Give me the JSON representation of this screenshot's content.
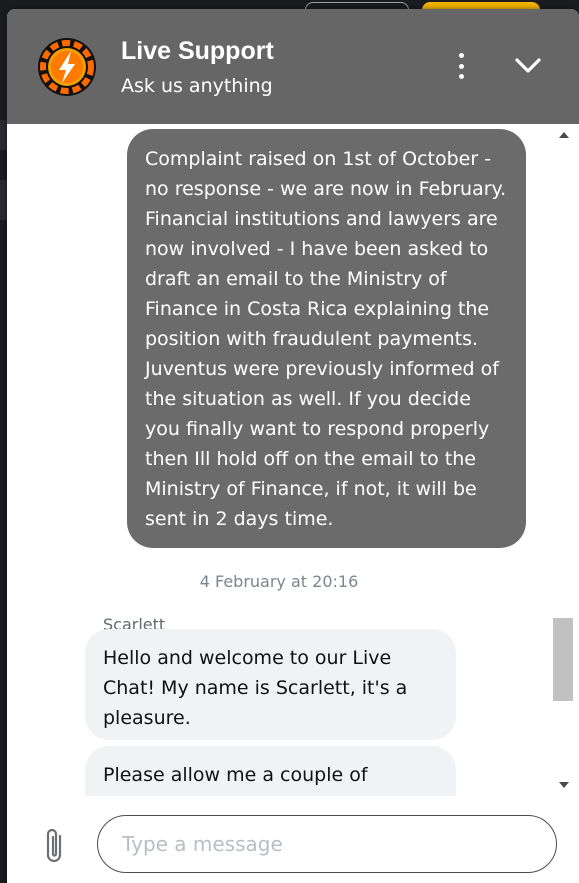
{
  "header": {
    "title": "Live Support",
    "subtitle": "Ask us anything",
    "icons": {
      "logo": "lightning-chip-logo",
      "menu": "kebab-menu-icon",
      "collapse": "chevron-down-icon"
    }
  },
  "messages": {
    "outgoing": [
      {
        "text": "Complaint raised on 1st of October - no response - we are now in February. Financial institutions and lawyers are now involved - I have been asked to draft an email to the Ministry of Finance in Costa Rica explaining the position with fraudulent payments. Juventus were previously informed of the situation as well. If you decide you finally want to respond properly then Ill hold off on the email to the Ministry of Finance, if not, it will be sent in 2 days time."
      }
    ],
    "timestamp": "4 February at 20:16",
    "agent_name": "Scarlett",
    "incoming": [
      {
        "text": "Hello and welcome to our Live Chat! My name is Scarlett, it's a pleasure."
      },
      {
        "text": "Please allow me a couple of"
      }
    ]
  },
  "composer": {
    "placeholder": "Type a message",
    "value": "",
    "attach_icon": "paperclip-icon"
  },
  "colors": {
    "header_bg": "#666666",
    "outgoing_bubble": "#6b6b6b",
    "incoming_bubble": "#f1f2f4",
    "accent_yellow": "#f5b301",
    "logo_orange": "#ff6a00"
  }
}
